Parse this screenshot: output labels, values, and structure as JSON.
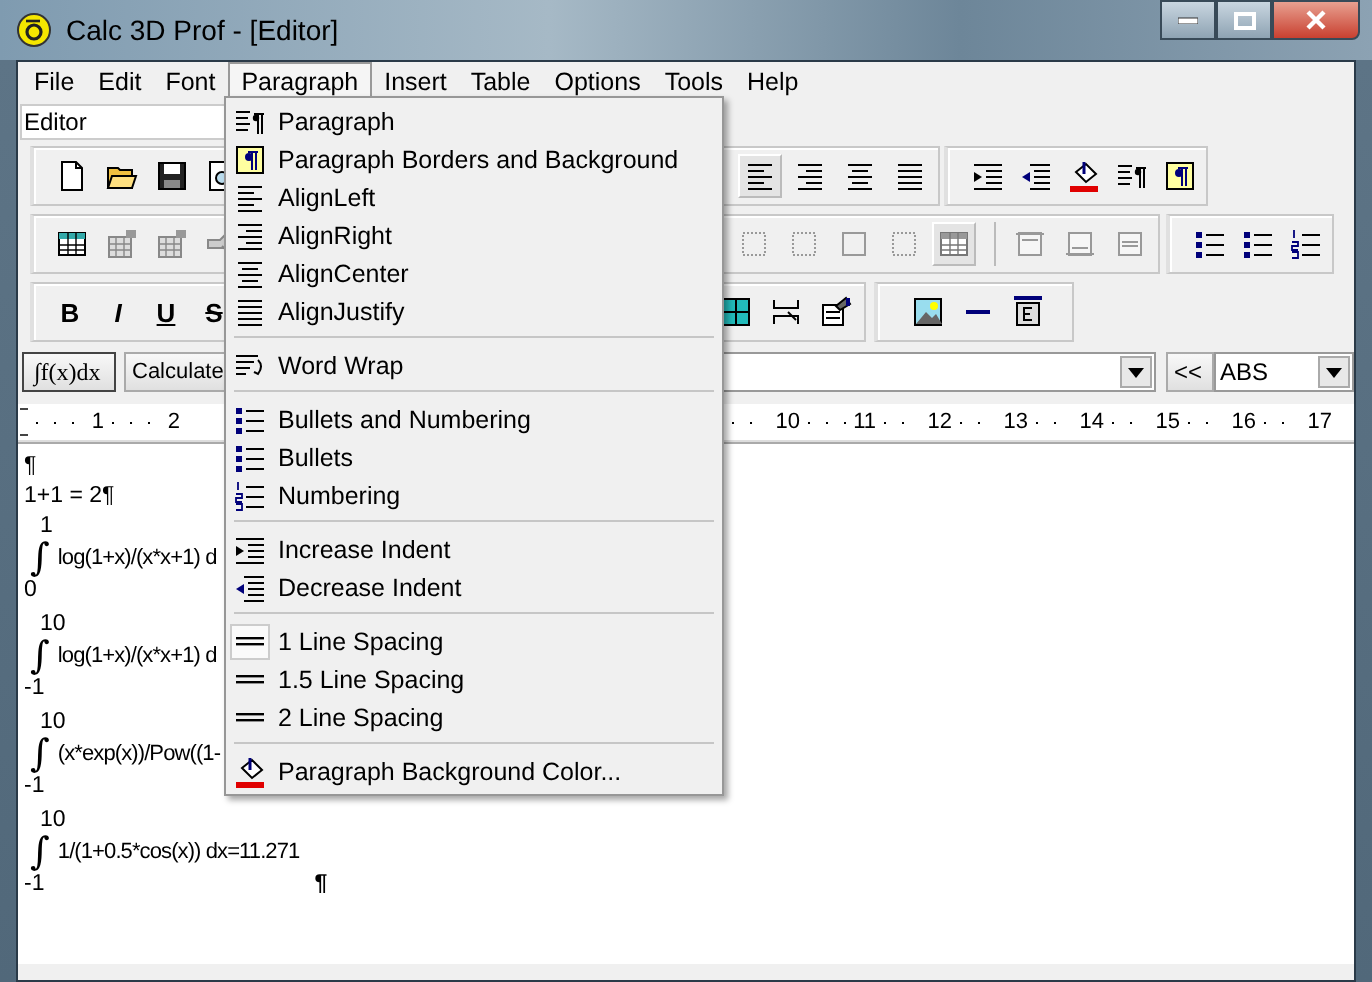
{
  "window": {
    "title": "Calc 3D Prof - [Editor]"
  },
  "menu_bar": [
    {
      "label": "File",
      "selected": false
    },
    {
      "label": "Edit",
      "selected": false
    },
    {
      "label": "Font",
      "selected": false
    },
    {
      "label": "Paragraph",
      "selected": true
    },
    {
      "label": "Insert",
      "selected": false
    },
    {
      "label": "Table",
      "selected": false
    },
    {
      "label": "Options",
      "selected": false
    },
    {
      "label": "Tools",
      "selected": false
    },
    {
      "label": "Help",
      "selected": false
    }
  ],
  "document_selector": {
    "value": "Editor"
  },
  "alignment_buttons": [
    {
      "selected": true
    },
    {
      "selected": false
    },
    {
      "selected": false
    },
    {
      "selected": false
    }
  ],
  "grid_button": {
    "selected": true
  },
  "format_buttons": [
    "B",
    "I",
    "U",
    "S"
  ],
  "formula_bar": {
    "integral_button": "∫f(x)dx",
    "calculate_button": "Calculate",
    "back_button": "<<",
    "function_combo": "ABS"
  },
  "ruler": {
    "start": [
      "1",
      "2"
    ],
    "end": [
      "10",
      "11",
      "12",
      "13",
      "14",
      "15",
      "16",
      "17"
    ]
  },
  "document": {
    "lines": [
      "¶",
      "1+1 = 2¶"
    ],
    "formulas": [
      {
        "upper": "1",
        "sign": "∫",
        "body": "log(1+x)/(x*x+1) d",
        "lower": "0"
      },
      {
        "upper": "10",
        "sign": "∫",
        "body": "log(1+x)/(x*x+1) d",
        "lower": "-1"
      },
      {
        "upper": "10",
        "sign": "∫",
        "body": "(x*exp(x))/Pow((1-",
        "lower": "-1"
      },
      {
        "upper": "10",
        "sign": "∫",
        "body": "1/(1+0.5*cos(x)) dx=11.271",
        "lower": "-1",
        "mark": "¶"
      }
    ]
  },
  "paragraph_menu": [
    {
      "kind": "item",
      "label": "Paragraph"
    },
    {
      "kind": "item",
      "label": "Paragraph Borders and Background"
    },
    {
      "kind": "item",
      "label": "AlignLeft"
    },
    {
      "kind": "item",
      "label": "AlignRight"
    },
    {
      "kind": "item",
      "label": "AlignCenter"
    },
    {
      "kind": "item",
      "label": "AlignJustify"
    },
    {
      "kind": "separator"
    },
    {
      "kind": "item",
      "label": "Word Wrap"
    },
    {
      "kind": "separator"
    },
    {
      "kind": "item",
      "label": "Bullets and Numbering"
    },
    {
      "kind": "item",
      "label": "Bullets"
    },
    {
      "kind": "item",
      "label": "Numbering"
    },
    {
      "kind": "separator"
    },
    {
      "kind": "item",
      "label": "Increase Indent"
    },
    {
      "kind": "item",
      "label": "Decrease Indent"
    },
    {
      "kind": "separator"
    },
    {
      "kind": "item",
      "label": "1 Line Spacing",
      "checked": true
    },
    {
      "kind": "item",
      "label": "1.5 Line Spacing",
      "checked": false
    },
    {
      "kind": "item",
      "label": "2 Line Spacing",
      "checked": false
    },
    {
      "kind": "separator"
    },
    {
      "kind": "item",
      "label": "Paragraph Background Color..."
    }
  ]
}
